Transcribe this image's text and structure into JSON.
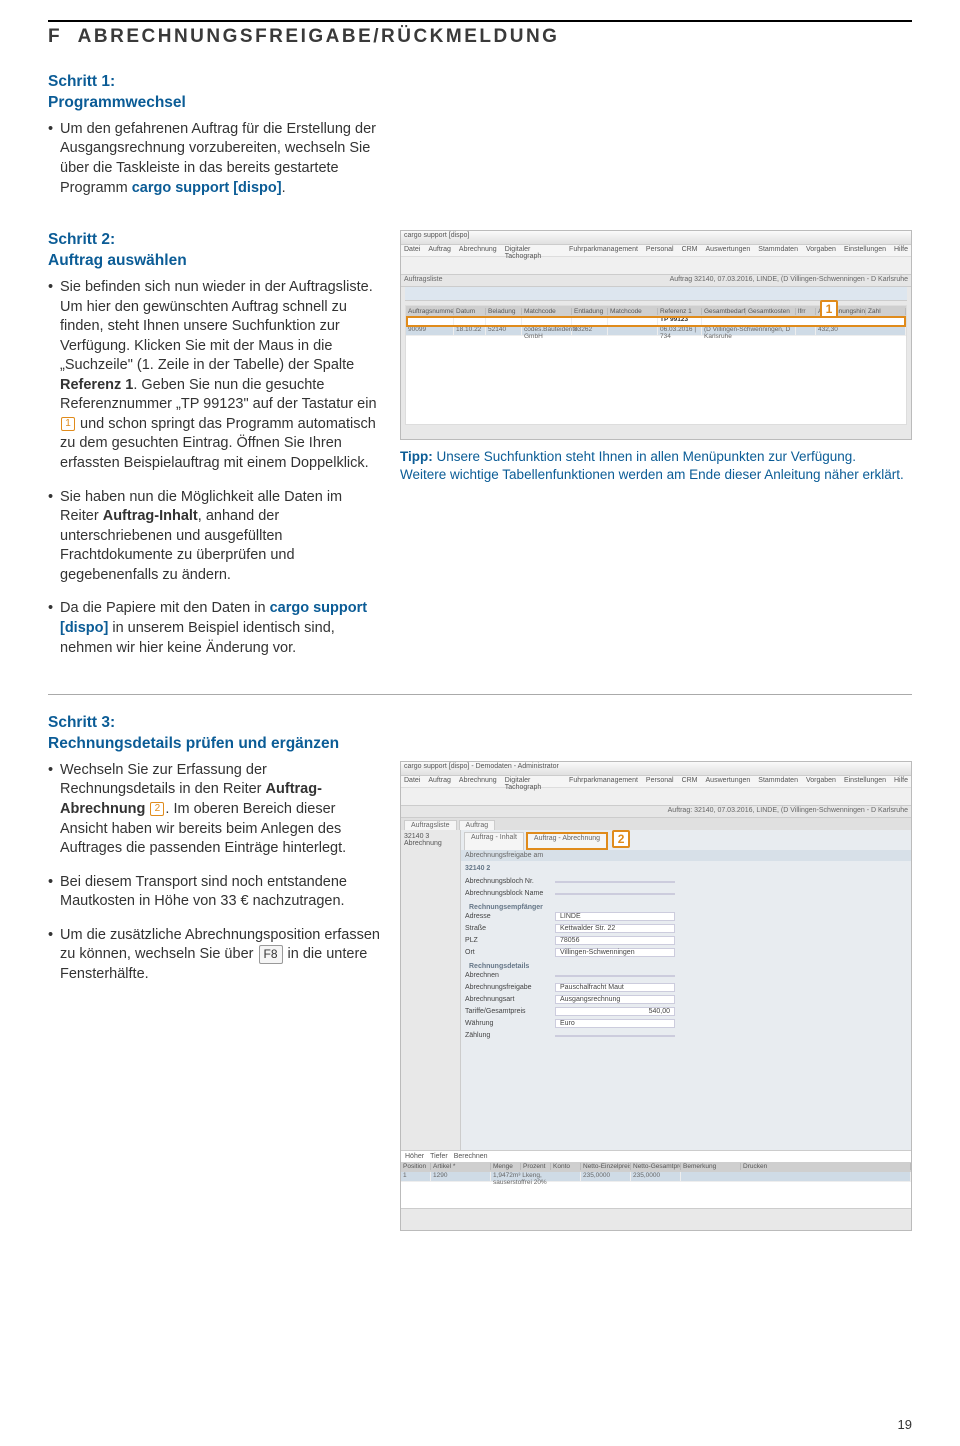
{
  "section_letter": "F",
  "section_name": "ABRECHNUNGSFREIGABE/RÜCKMELDUNG",
  "step1": {
    "title_a": "Schritt 1:",
    "title_b": "Programmwechsel",
    "bullet": "Um den gefahrenen Auftrag für die Erstellung der Ausgangsrechnung vorzubereiten, wechseln Sie über die Taskleiste in das bereits gestartete Programm ",
    "prog": "cargo support [dispo]",
    "bullet_end": "."
  },
  "step2": {
    "title_a": "Schritt 2:",
    "title_b": "Auftrag auswählen",
    "bullets": [
      {
        "pre": "Sie befinden sich nun wieder in der Auftragsliste. Um hier den gewünschten Auftrag schnell zu finden, steht Ihnen unsere Suchfunktion zur Verfügung. Klicken Sie mit der Maus in die „Suchzeile\" (1. Zeile in der Tabelle) der Spalte ",
        "bold1": "Referenz 1",
        "mid": ". Geben Sie nun die gesuchte Referenznummer „TP 99123\" auf der Tastatur ein ",
        "bubble": "1",
        "post": " und schon springt das Programm automatisch zu dem gesuchten Eintrag. Öffnen Sie Ihren erfassten Beispielauftrag mit einem Doppelklick."
      },
      {
        "text_a": "Sie haben nun die Möglichkeit alle Daten im Reiter ",
        "bold": "Auftrag-Inhalt",
        "text_b": ", anhand der unterschriebenen und ausgefüllten Frachtdokumente zu überprüfen und gegebenenfalls zu ändern."
      },
      {
        "text_a": "Da die Papiere mit den Daten in ",
        "bold": "cargo support [dispo]",
        "text_b": " in unserem Beispiel identisch sind, nehmen wir hier keine Änderung vor."
      }
    ]
  },
  "tip": {
    "label": "Tipp:",
    "line1": " Unsere Suchfunktion steht Ihnen in allen Menüpunkten zur Verfügung.",
    "line2": "Weitere wichtige Tabellenfunktionen werden am Ende dieser Anleitung näher erklärt."
  },
  "step3": {
    "title_a": "Schritt 3:",
    "title_b": "Rechnungsdetails prüfen und ergänzen",
    "bullets": [
      {
        "text_a": "Wechseln Sie zur Erfassung der Rechnungsdetails in den Reiter ",
        "bold": "Auftrag-Abrechnung",
        "bubble": "2",
        "text_b": ". Im oberen Bereich dieser Ansicht haben wir bereits beim Anlegen des Auftrages die passenden Einträge hinterlegt."
      },
      {
        "text": "Bei diesem Transport sind noch entstandene Mautkosten in Höhe von 33 € nachzutragen."
      },
      {
        "text_a": "Um die zusätzliche Abrechnungsposition erfassen zu können, wechseln Sie über ",
        "key": "F8",
        "text_b": " in die untere Fensterhälfte."
      }
    ]
  },
  "screenshot1": {
    "title": "cargo support [dispo]",
    "menu": [
      "Datei",
      "Auftrag",
      "Abrechnung",
      "Digitaler Tachograph",
      "Fuhrparkmanagement",
      "Personal",
      "CRM",
      "Auswertungen",
      "Stammdaten",
      "Vorgaben",
      "Einstellungen",
      "Hilfe"
    ],
    "status": "Auftrag 32140, 07.03.2016, LINDE, (D Villingen-Schwenningen - D Karlsruhe",
    "tabs": [
      "Auftragsliste"
    ],
    "headers": [
      "Auftragsnummer",
      "Datum",
      "Beladung",
      "Matchcode",
      "Entladung",
      "Matchcode",
      "Referenz 1",
      "Gesamtbedarf",
      "Gesamtkosten",
      "lfrr",
      "Abrechnungshint",
      "Zahl"
    ],
    "search_val": "TP 99123",
    "row": [
      "90099",
      "18.10.22",
      "52140",
      "codes.Bauteiderite GmbH",
      "83262",
      "",
      "06.03.2016 | 734",
      "(D Villingen-Schwenningen, D Karlsruhe",
      "",
      "432,30"
    ],
    "marker": "1"
  },
  "screenshot2": {
    "title": "cargo support [dispo] - Demodaten - Administrator",
    "menu": [
      "Datei",
      "Auftrag",
      "Abrechnung",
      "Digitaler Tachograph",
      "Fuhrparkmanagement",
      "Personal",
      "CRM",
      "Auswertungen",
      "Stammdaten",
      "Vorgaben",
      "Einstellungen",
      "Hilfe"
    ],
    "status": "Auftrag: 32140, 07.03.2016, LINDE, (D Villingen-Schwenningen - D Karlsruhe",
    "outer_tabs": [
      "Auftragsliste",
      "Auftrag"
    ],
    "inner_tabs": [
      "Auftrag - Inhalt",
      "Auftrag - Abrechnung"
    ],
    "left_pane": "32140 3\nAbrechnung",
    "section_label": "Abrechnungsfreigabe am",
    "details": {
      "Abrechnungsinfo": "32140 2",
      "Abrechnungsbloch Nr": "",
      "Abrechnungsblock Name": "",
      "Rechnungsempfänger": "",
      "Adresse": "LINDE",
      "Straße": "Kettwalder Str. 22",
      "PLZ": "78056",
      "Ort": "Villingen-Schwenningen",
      "Rechnungsdetails": "",
      "Abrechnen": "",
      "Abrechnungsfreigabe": "Pauschalfracht Maut",
      "Abrechnungsart": "Ausgangsrechnung",
      "Tariffe/Gesamtpreis": "540,00",
      "Währung": "Euro",
      "Zählung": ""
    },
    "footer_buttons": [
      "Höher",
      "Tiefer",
      "Berechnen"
    ],
    "grid_headers": [
      "Position",
      "Artikel *",
      "Menge",
      "Prozent",
      "Konto",
      "Netto-Einzelpreis",
      "Netto-Gesamtpreis",
      "Bemerkung",
      "Drucken"
    ],
    "grid_row": [
      "1",
      "1290",
      "1,9472m³ Lkeng, sauserstoffrei 20%",
      "235,0000",
      "235,0000"
    ],
    "marker": "2"
  },
  "page_number": "19"
}
